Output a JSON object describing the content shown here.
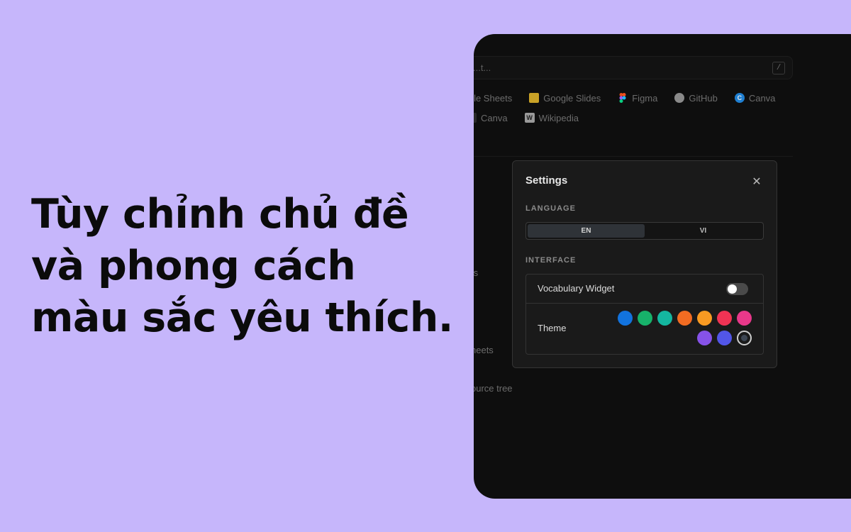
{
  "headline": {
    "line1": "Tùy chỉnh chủ đề",
    "line2": "và phong cách",
    "line3": "màu sắc yêu thích."
  },
  "background": {
    "search_text": "...t...",
    "search_shortcut": "/",
    "bookmarks_row1": [
      "...gle Sheets",
      "Google Slides",
      "Figma",
      "GitHub",
      "Canva"
    ],
    "bookmarks_row2": [
      "Canva",
      "Wikipedia"
    ],
    "ghost_text_1": "ts",
    "ghost_text_2": "heets",
    "ghost_text_3": "ource tree"
  },
  "settings": {
    "title": "Settings",
    "close_icon": "close-icon",
    "language_label": "LANGUAGE",
    "languages": [
      "EN",
      "VI"
    ],
    "language_selected": "EN",
    "interface_label": "INTERFACE",
    "vocab_widget_label": "Vocabulary Widget",
    "vocab_widget_enabled": false,
    "theme_label": "Theme",
    "theme_colors": [
      "#1273de",
      "#17b26a",
      "#14b7a0",
      "#f26c22",
      "#f89a22",
      "#ef3354",
      "#e8388a",
      "#8652e8",
      "#5256e8",
      "#3d4653"
    ],
    "theme_selected_index": 9
  },
  "colors": {
    "page_bg": "#c6b6fb",
    "device_bg": "#0e0e0e",
    "modal_bg": "#1a1a1a"
  }
}
